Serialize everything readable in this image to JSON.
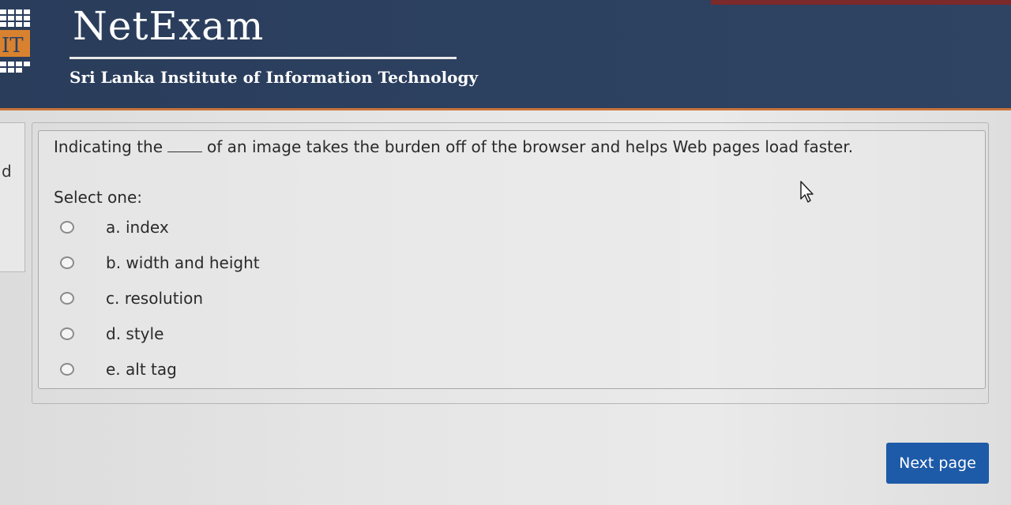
{
  "header": {
    "brand_title": "NetExam",
    "institute": "Sri Lanka Institute of Information Technology",
    "logo_text": "IT",
    "accent_color": "#c9743a",
    "background_color": "#2c4060"
  },
  "side": {
    "letter": "d"
  },
  "question": {
    "text_before": "Indicating the",
    "text_after": "of an image takes the burden off of the browser and helps Web pages load faster.",
    "prompt": "Select one:",
    "options": [
      {
        "label": "a. index"
      },
      {
        "label": "b. width and height"
      },
      {
        "label": "c. resolution"
      },
      {
        "label": "d. style"
      },
      {
        "label": "e. alt tag"
      }
    ]
  },
  "actions": {
    "next_label": "Next page",
    "next_color": "#1d5aa8"
  },
  "icons": {
    "logo": "sliit-logo-icon",
    "cursor": "mouse-cursor-icon",
    "radio": "radio-button-icon"
  }
}
